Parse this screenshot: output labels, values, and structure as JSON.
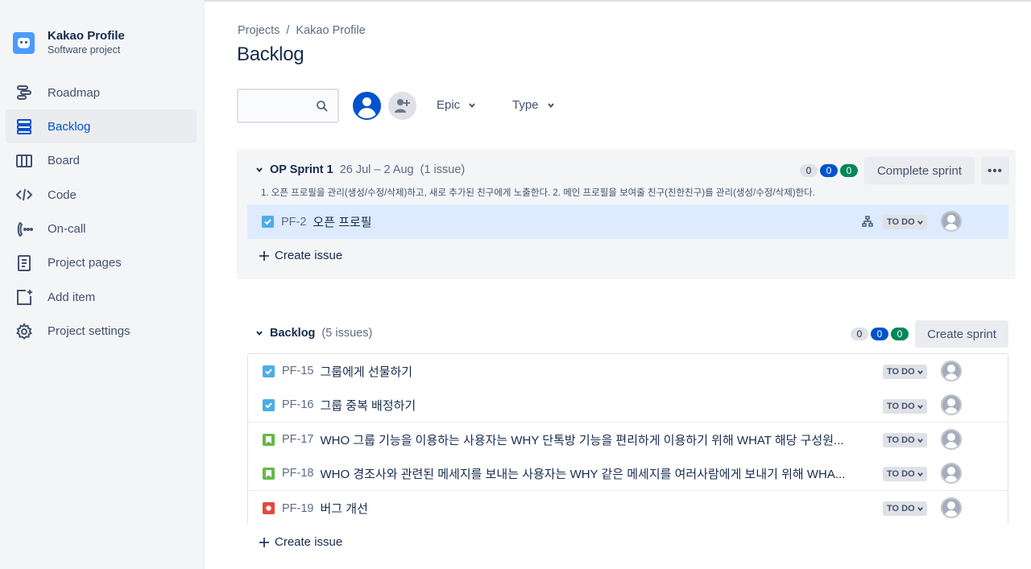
{
  "project": {
    "name": "Kakao Profile",
    "type": "Software project"
  },
  "sidebar": {
    "items": [
      {
        "label": "Roadmap",
        "icon": "roadmap-icon",
        "active": false
      },
      {
        "label": "Backlog",
        "icon": "backlog-icon",
        "active": true
      },
      {
        "label": "Board",
        "icon": "board-icon",
        "active": false
      },
      {
        "label": "Code",
        "icon": "code-icon",
        "active": false
      },
      {
        "label": "On-call",
        "icon": "on-call-icon",
        "active": false
      },
      {
        "label": "Project pages",
        "icon": "pages-icon",
        "active": false
      },
      {
        "label": "Add item",
        "icon": "add-item-icon",
        "active": false
      },
      {
        "label": "Project settings",
        "icon": "gear-icon",
        "active": false
      }
    ]
  },
  "breadcrumb": {
    "root": "Projects",
    "separator": "/",
    "current": "Kakao Profile"
  },
  "page_title": "Backlog",
  "toolbar": {
    "search": {
      "value": "",
      "placeholder": ""
    },
    "filters": {
      "epic": "Epic",
      "type": "Type"
    }
  },
  "sprint": {
    "name": "OP Sprint 1",
    "dates": "26 Jul – 2 Aug",
    "issue_count": "(1 issue)",
    "counts": {
      "todo": "0",
      "in_progress": "0",
      "done": "0"
    },
    "complete_label": "Complete sprint",
    "more_label": "•••",
    "goal": "1. 오픈 프로필을 관리(생성/수정/삭제)하고, 새로 추가된 친구에게 노출한다. 2. 메인 프로필을 보여줄 친구(친한친구)를 관리(생성/수정/삭제)한다.",
    "issues": [
      {
        "key": "PF-2",
        "summary": "오픈 프로필",
        "type": "task",
        "status": "TO DO"
      }
    ],
    "create_label": "Create issue"
  },
  "backlog": {
    "name": "Backlog",
    "issue_count": "(5 issues)",
    "counts": {
      "todo": "0",
      "in_progress": "0",
      "done": "0"
    },
    "create_sprint_label": "Create sprint",
    "issues": [
      {
        "key": "PF-15",
        "summary": "그룹에게 선물하기",
        "type": "task",
        "status": "TO DO"
      },
      {
        "key": "PF-16",
        "summary": "그룹 중복 배정하기",
        "type": "task",
        "status": "TO DO"
      },
      {
        "key": "PF-17",
        "summary": "WHO 그룹 기능을 이용하는 사용자는 WHY 단톡방 기능을 편리하게 이용하기 위해 WHAT 해당 구성원...",
        "type": "story",
        "status": "TO DO"
      },
      {
        "key": "PF-18",
        "summary": "WHO 경조사와 관련된 메세지를 보내는 사용자는 WHY 같은 메세지를 여러사람에게 보내기 위해 WHA...",
        "type": "story",
        "status": "TO DO"
      },
      {
        "key": "PF-19",
        "summary": "버그 개선",
        "type": "bug",
        "status": "TO DO"
      }
    ],
    "create_label": "Create issue"
  },
  "colors": {
    "accent": "#0052cc",
    "selected_row": "#deebff",
    "task": "#4bade8",
    "story": "#65ba43",
    "bug": "#e5493a"
  }
}
